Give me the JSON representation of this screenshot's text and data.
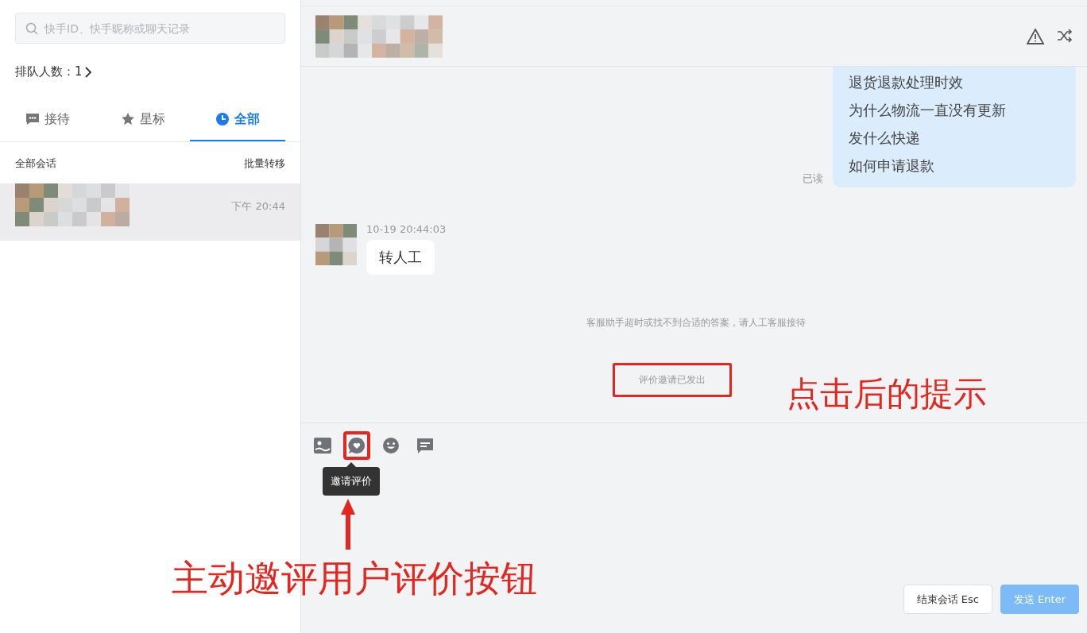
{
  "sidebar": {
    "search": {
      "placeholder": "快手ID、快手昵称或聊天记录"
    },
    "queue": {
      "label": "排队人数：",
      "count": "1"
    },
    "tabs": [
      {
        "label": "接待",
        "selected": false
      },
      {
        "label": "星标",
        "selected": false
      },
      {
        "label": "全部",
        "selected": true
      }
    ],
    "list_header": {
      "title": "全部会话",
      "action": "批量转移"
    },
    "conversations": [
      {
        "time": "下午 20:44",
        "selected": true
      }
    ]
  },
  "chat": {
    "messages": [
      {
        "kind": "outgoing",
        "lines": [
          "退货退款处理时效",
          "为什么物流一直没有更新",
          "发什么快递",
          "如何申请退款"
        ],
        "status": "已读"
      },
      {
        "kind": "incoming",
        "time": "10-19 20:44:03",
        "text": "转人工"
      },
      {
        "kind": "system",
        "text": "客服助手超时或找不到合适的答案，请人工客服接待",
        "highlighted": false
      },
      {
        "kind": "system",
        "text": "评价邀请已发出",
        "highlighted": true
      }
    ],
    "toolbar": [
      {
        "highlighted": false
      },
      {
        "highlighted": true
      },
      {
        "highlighted": false
      },
      {
        "highlighted": false
      }
    ],
    "tooltip": "邀请评价",
    "buttons": [
      {
        "label": "结束会话 Esc",
        "kind": "secondary"
      },
      {
        "label": "发送 Enter",
        "kind": "primary",
        "disabled": true
      }
    ]
  },
  "annotations": [
    {
      "text": "点击后的提示"
    },
    {
      "text": "主动邀评用户评价按钮"
    }
  ]
}
